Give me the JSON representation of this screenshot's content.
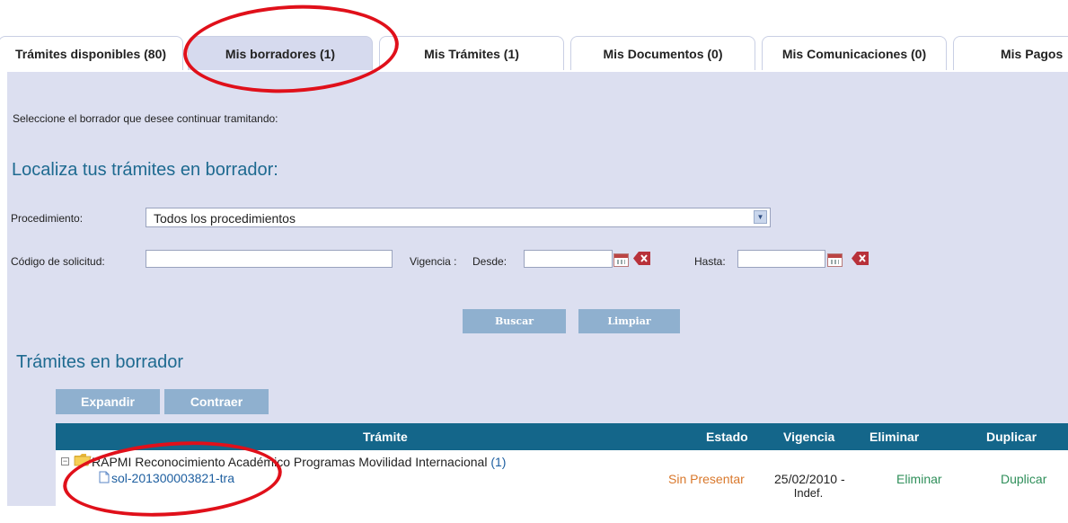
{
  "tabs": [
    {
      "label": "Trámites disponibles (80)",
      "active": false
    },
    {
      "label": "Mis borradores (1)",
      "active": true
    },
    {
      "label": "Mis Trámites (1)",
      "active": false
    },
    {
      "label": "Mis Documentos (0)",
      "active": false
    },
    {
      "label": "Mis Comunicaciones (0)",
      "active": false
    },
    {
      "label": "Mis Pagos",
      "active": false
    }
  ],
  "intro": "Seleccione el borrador que desee continuar tramitando:",
  "search": {
    "title": "Localiza tus trámites en borrador:",
    "procedimiento_label": "Procedimiento:",
    "procedimiento_value": "Todos los procedimientos",
    "codigo_label": "Código de solicitud:",
    "codigo_value": "",
    "vigencia_label": "Vigencia :",
    "desde_label": "Desde:",
    "hasta_label": "Hasta:",
    "buscar": "Buscar",
    "limpiar": "Limpiar"
  },
  "results": {
    "title": "Trámites en borrador",
    "expandir": "Expandir",
    "contraer": "Contraer",
    "columns": [
      "Trámite",
      "Estado",
      "Vigencia",
      "Eliminar",
      "Duplicar"
    ],
    "group": {
      "name": "RAPMI Reconocimiento Académico Programas Movilidad Internacional",
      "count": "(1)",
      "item": "sol-201300003821-tra",
      "estado": "Sin Presentar",
      "vigencia_line1": "25/02/2010 -",
      "vigencia_line2": "Indef.",
      "eliminar": "Eliminar",
      "duplicar": "Duplicar"
    }
  },
  "colors": {
    "panel": "#dcdff0",
    "header": "#14668a",
    "title": "#1e6a90",
    "estado": "#d9782c",
    "action": "#2f8f5a",
    "annotation": "#e0101a"
  }
}
